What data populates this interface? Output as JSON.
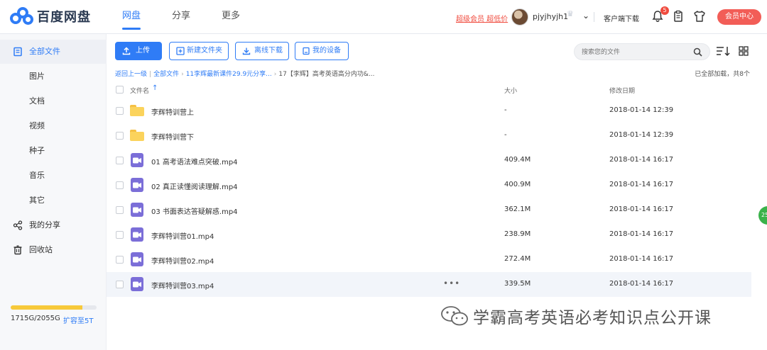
{
  "app": {
    "brand": "百度网盘",
    "nav": [
      "网盘",
      "分享",
      "更多"
    ],
    "vip_link": "超级会员 超低价",
    "username": "pjyjhyjh1",
    "client_download": "客户端下载",
    "notification_count": "5",
    "member_center": "会员中心"
  },
  "sidebar": {
    "items": [
      {
        "label": "全部文件",
        "icon": "all-files-icon"
      },
      {
        "label": "图片"
      },
      {
        "label": "文档"
      },
      {
        "label": "视频"
      },
      {
        "label": "种子"
      },
      {
        "label": "音乐"
      },
      {
        "label": "其它"
      },
      {
        "label": "我的分享",
        "icon": "share-icon"
      },
      {
        "label": "回收站",
        "icon": "trash-icon"
      }
    ],
    "quota_text": "1715G/2055G",
    "quota_fraction": 0.8345,
    "expand_label": "扩容至5T"
  },
  "toolbar": {
    "upload": "上传",
    "new_folder": "新建文件夹",
    "offline_download": "离线下载",
    "my_devices": "我的设备",
    "search_placeholder": "搜索您的文件"
  },
  "breadcrumb": {
    "back": "返回上一级",
    "all_files": "全部文件",
    "parent": "11李辉最新课件29.9元分享...",
    "current": "17【李辉】高考英语高分内功&...",
    "loaded": "已全部加载，共8个"
  },
  "table": {
    "headers": {
      "name": "文件名",
      "size": "大小",
      "date": "修改日期"
    },
    "rows": [
      {
        "type": "folder",
        "name": "李辉特训营上",
        "size": "-",
        "date": "2018-01-14 12:39"
      },
      {
        "type": "folder",
        "name": "李辉特训营下",
        "size": "-",
        "date": "2018-01-14 12:39"
      },
      {
        "type": "video",
        "name": "01 高考语法难点突破.mp4",
        "size": "409.4M",
        "date": "2018-01-14 16:17"
      },
      {
        "type": "video",
        "name": "02 真正读懂阅读理解.mp4",
        "size": "400.9M",
        "date": "2018-01-14 16:17"
      },
      {
        "type": "video",
        "name": "03 书面表达答疑解惑.mp4",
        "size": "362.1M",
        "date": "2018-01-14 16:17"
      },
      {
        "type": "video",
        "name": "李辉特训营01.mp4",
        "size": "238.9M",
        "date": "2018-01-14 16:17"
      },
      {
        "type": "video",
        "name": "李辉特训营02.mp4",
        "size": "272.4M",
        "date": "2018-01-14 16:17"
      },
      {
        "type": "video",
        "name": "李辉特训营03.mp4",
        "size": "339.5M",
        "date": "2018-01-14 16:17",
        "hover": true
      }
    ]
  },
  "float_badge": "25",
  "watermark": "学霸高考英语必考知识点公开课",
  "colors": {
    "accent": "#2f7cf6",
    "vip": "#f04b3e",
    "video_icon": "#7b6ed8",
    "folder": "#fbd35c",
    "quota": "#f7c93a"
  }
}
